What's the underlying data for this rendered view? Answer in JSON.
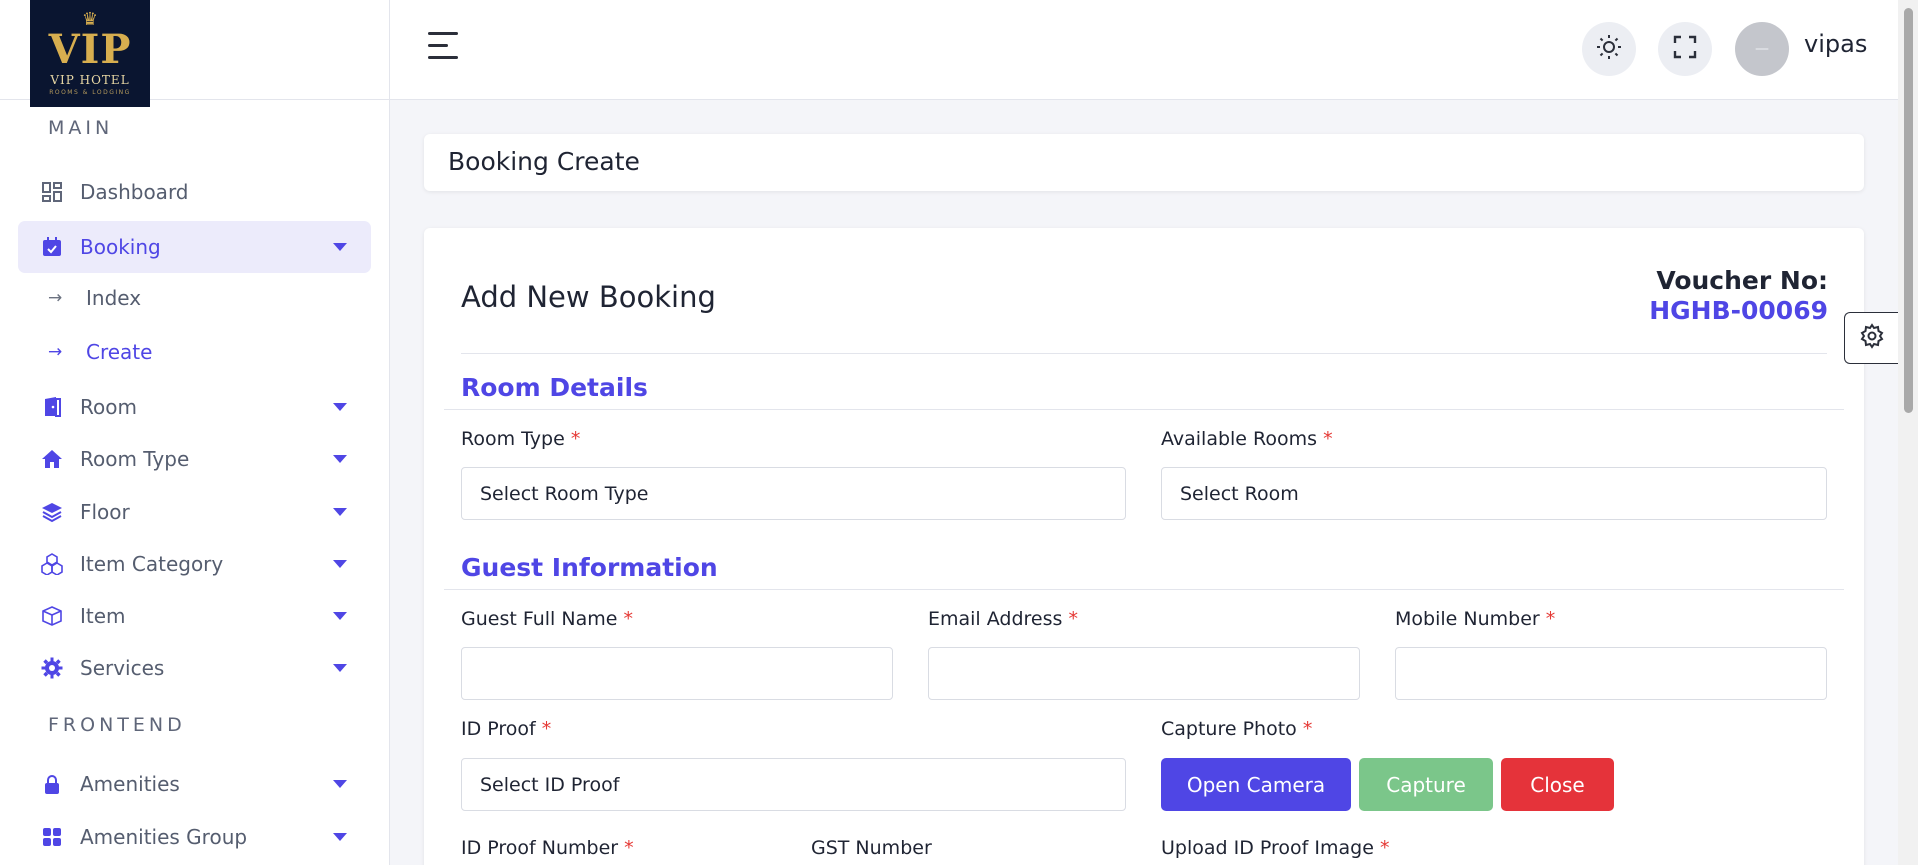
{
  "brand": {
    "logo_text": "VIP",
    "logo_name": "VIP HOTEL",
    "logo_sub": "ROOMS & LODGING"
  },
  "sidebar": {
    "main_heading": "MAIN",
    "frontend_heading": "FRONTEND",
    "items": [
      {
        "label": "Dashboard",
        "icon": "dashboard-icon"
      },
      {
        "label": "Booking",
        "icon": "calendar-check-icon",
        "active": true
      },
      {
        "label": "Room",
        "icon": "door-icon"
      },
      {
        "label": "Room Type",
        "icon": "home-icon"
      },
      {
        "label": "Floor",
        "icon": "layers-icon"
      },
      {
        "label": "Item Category",
        "icon": "cubes-icon"
      },
      {
        "label": "Item",
        "icon": "box-icon"
      },
      {
        "label": "Services",
        "icon": "gear-icon"
      },
      {
        "label": "Amenities",
        "icon": "lock-icon"
      },
      {
        "label": "Amenities Group",
        "icon": "grid-icon"
      }
    ],
    "booking_sub": [
      {
        "label": "Index"
      },
      {
        "label": "Create",
        "active": true
      }
    ]
  },
  "header": {
    "user_name": "vipas",
    "avatar_text": "—",
    "icons": [
      "menu-icon",
      "sun-icon",
      "fullscreen-icon"
    ]
  },
  "page": {
    "title": "Booking Create"
  },
  "form": {
    "title": "Add New Booking",
    "voucher_label": "Voucher No:",
    "voucher_no": "HGHB-00069",
    "room_section": "Room Details",
    "guest_section": "Guest Information",
    "room_type": {
      "label": "Room Type",
      "value": "Select Room Type"
    },
    "available_rooms": {
      "label": "Available Rooms",
      "value": "Select Room"
    },
    "guest_name": {
      "label": "Guest Full Name",
      "value": ""
    },
    "email": {
      "label": "Email Address",
      "value": ""
    },
    "mobile": {
      "label": "Mobile Number",
      "value": ""
    },
    "id_proof": {
      "label": "ID Proof",
      "value": "Select ID Proof"
    },
    "capture_photo": {
      "label": "Capture Photo"
    },
    "buttons": {
      "open_camera": "Open Camera",
      "capture": "Capture",
      "close": "Close"
    },
    "id_proof_number": {
      "label": "ID Proof Number"
    },
    "gst_number": {
      "label": "GST Number"
    },
    "upload_id": {
      "label": "Upload ID Proof Image"
    },
    "required_mark": "*"
  },
  "colors": {
    "accent": "#4f46e5",
    "success": "#7bc68a",
    "danger": "#e5333a"
  }
}
